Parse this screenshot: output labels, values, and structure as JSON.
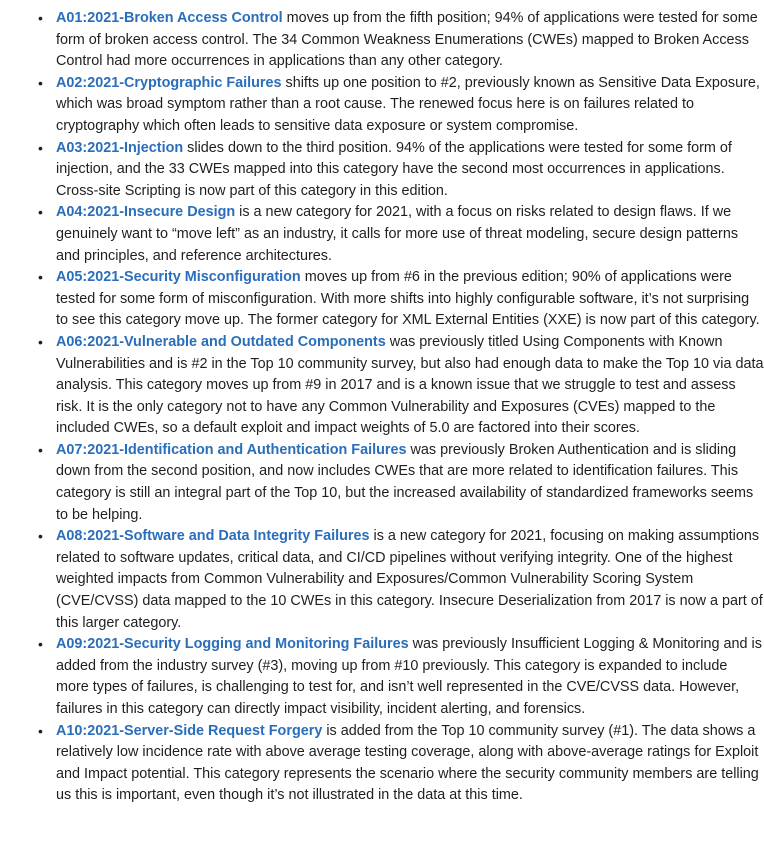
{
  "items": [
    {
      "link": "A01:2021-Broken Access Control",
      "text": " moves up from the fifth position; 94% of applications were tested for some form of broken access control. The 34 Common Weakness Enumerations (CWEs) mapped to Broken Access Control had more occurrences in applications than any other category."
    },
    {
      "link": "A02:2021-Cryptographic Failures",
      "text": " shifts up one position to #2, previously known as Sensitive Data Exposure, which was broad symptom rather than a root cause. The renewed focus here is on failures related to cryptography which often leads to sensitive data exposure or system compromise."
    },
    {
      "link": "A03:2021-Injection",
      "text": " slides down to the third position. 94% of the applications were tested for some form of injection, and the 33 CWEs mapped into this category have the second most occurrences in applications. Cross-site Scripting is now part of this category in this edition."
    },
    {
      "link": "A04:2021-Insecure Design",
      "text": " is a new category for 2021, with a focus on risks related to design flaws. If we genuinely want to “move left” as an industry, it calls for more use of threat modeling, secure design patterns and principles, and reference architectures."
    },
    {
      "link": "A05:2021-Security Misconfiguration",
      "text": " moves up from #6 in the previous edition; 90% of applications were tested for some form of misconfiguration. With more shifts into highly configurable software, it’s not surprising to see this category move up. The former category for XML External Entities (XXE) is now part of this category."
    },
    {
      "link": "A06:2021-Vulnerable and Outdated Components",
      "text": " was previously titled Using Components with Known Vulnerabilities and is #2 in the Top 10 community survey, but also had enough data to make the Top 10 via data analysis. This category moves up from #9 in 2017 and is a known issue that we struggle to test and assess risk. It is the only category not to have any Common Vulnerability and Exposures (CVEs) mapped to the included CWEs, so a default exploit and impact weights of 5.0 are factored into their scores."
    },
    {
      "link": "A07:2021-Identification and Authentication Failures",
      "text": " was previously Broken Authentication and is sliding down from the second position, and now includes CWEs that are more related to identification failures. This category is still an integral part of the Top 10, but the increased availability of standardized frameworks seems to be helping."
    },
    {
      "link": "A08:2021-Software and Data Integrity Failures",
      "text": " is a new category for 2021, focusing on making assumptions related to software updates, critical data, and CI/CD pipelines without verifying integrity. One of the highest weighted impacts from Common Vulnerability and Exposures/Common Vulnerability Scoring System (CVE/CVSS) data mapped to the 10 CWEs in this category. Insecure Deserialization from 2017 is now a part of this larger category."
    },
    {
      "link": "A09:2021-Security Logging and Monitoring Failures",
      "text": " was previously Insufficient Logging & Monitoring and is added from the industry survey (#3), moving up from #10 previously. This category is expanded to include more types of failures, is challenging to test for, and isn’t well represented in the CVE/CVSS data. However, failures in this category can directly impact visibility, incident alerting, and forensics."
    },
    {
      "link": "A10:2021-Server-Side Request Forgery",
      "text": " is added from the Top 10 community survey (#1). The data shows a relatively low incidence rate with above average testing coverage, along with above-average ratings for Exploit and Impact potential. This category represents the scenario where the security community members are telling us this is important, even though it’s not illustrated in the data at this time."
    }
  ]
}
